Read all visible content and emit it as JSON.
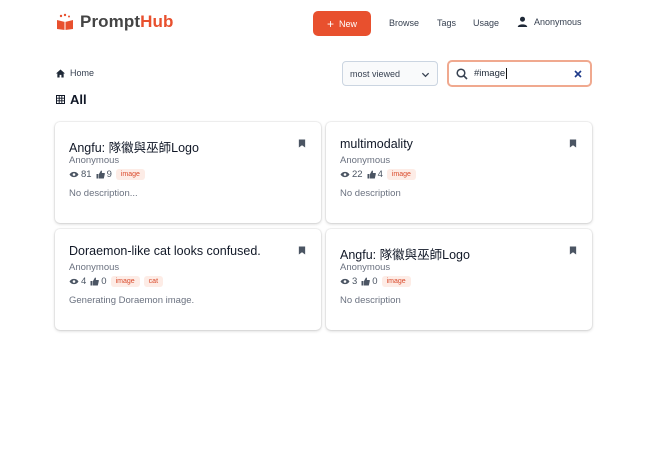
{
  "app": {
    "name_part1": "Prompt",
    "name_part2": "Hub",
    "accent": "#e8502e"
  },
  "header": {
    "new_label": "New",
    "nav": [
      "Browse",
      "Tags",
      "Usage"
    ],
    "user": "Anonymous"
  },
  "breadcrumb": {
    "home": "Home"
  },
  "controls": {
    "sort_value": "most viewed",
    "search_value": "#image"
  },
  "section": {
    "title": "All"
  },
  "cards": [
    {
      "title": "Angfu: 隊徽與巫師Logo",
      "author": "Anonymous",
      "views": "81",
      "likes": "9",
      "tags": [
        "image"
      ],
      "description": "No description..."
    },
    {
      "title": "multimodality",
      "author": "Anonymous",
      "views": "22",
      "likes": "4",
      "tags": [
        "image"
      ],
      "description": "No description"
    },
    {
      "title": "Doraemon-like cat looks confused.",
      "author": "Anonymous",
      "views": "4",
      "likes": "0",
      "tags": [
        "image",
        "cat"
      ],
      "description": "Generating Doraemon image."
    },
    {
      "title": "Angfu: 隊徽與巫師Logo",
      "author": "Anonymous",
      "views": "3",
      "likes": "0",
      "tags": [
        "image"
      ],
      "description": "No description"
    }
  ]
}
